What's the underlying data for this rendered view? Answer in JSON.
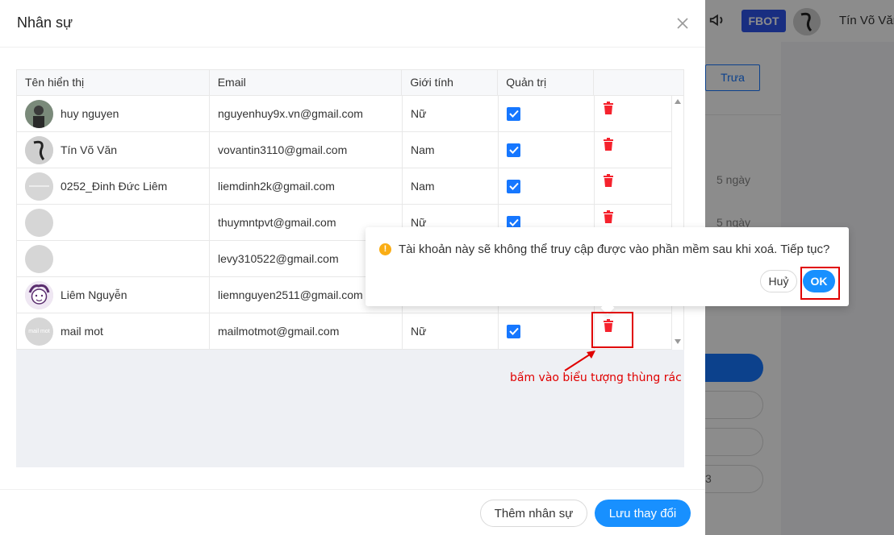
{
  "background": {
    "badge": "FBOT",
    "username": "Tín Võ Văn",
    "tab_button": "Trưa",
    "days": [
      "5 ngày",
      "5 ngày"
    ],
    "number": "3"
  },
  "modal": {
    "title": "Nhân sự",
    "columns": [
      "Tên hiển thị",
      "Email",
      "Giới tính",
      "Quản trị",
      ""
    ],
    "rows": [
      {
        "name": "huy nguyen",
        "email": "nguyenhuy9x.vn@gmail.com",
        "gender": "Nữ",
        "admin": true
      },
      {
        "name": "Tín Võ Văn",
        "email": "vovantin3110@gmail.com",
        "gender": "Nam",
        "admin": true
      },
      {
        "name": "0252_Đinh Đức Liêm",
        "email": "liemdinh2k@gmail.com",
        "gender": "Nam",
        "admin": true
      },
      {
        "name": "",
        "email": "thuymntpvt@gmail.com",
        "gender": "Nữ",
        "admin": true
      },
      {
        "name": "",
        "email": "levy310522@gmail.com",
        "gender": "",
        "admin": false
      },
      {
        "name": "Liêm Nguyễn",
        "email": "liemnguyen2511@gmail.com",
        "gender": "",
        "admin": false
      },
      {
        "name": "mail mot",
        "email": "mailmotmot@gmail.com",
        "gender": "Nữ",
        "admin": true
      }
    ],
    "avatar_text_mailmot": "mail mot",
    "footer": {
      "add_label": "Thêm nhân sự",
      "save_label": "Lưu thay đổi"
    }
  },
  "popconfirm": {
    "message": "Tài khoản này sẽ không thể truy cập được vào phần mềm sau khi xoá. Tiếp tục?",
    "cancel_label": "Huỷ",
    "ok_label": "OK"
  },
  "annotation": {
    "text": "bấm vào biểu tượng thùng rác"
  },
  "colors": {
    "primary": "#1890ff",
    "danger": "#f5222d",
    "warning": "#faad14",
    "annotation_red": "#e00000",
    "badge_blue": "#2f54eb"
  }
}
